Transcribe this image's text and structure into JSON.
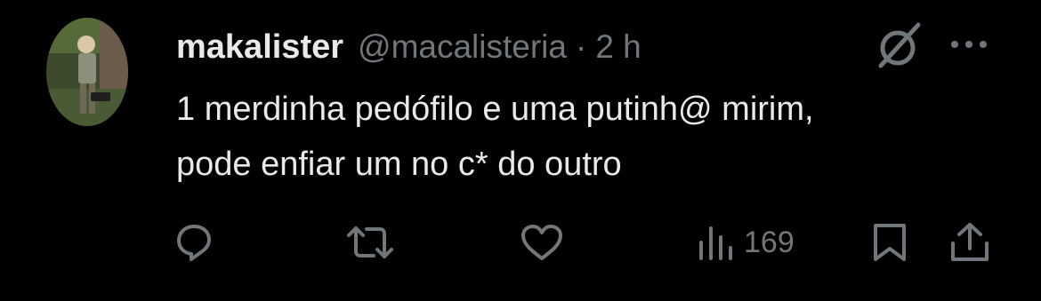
{
  "tweet": {
    "display_name": "makalister",
    "handle": "@macalisteria",
    "separator": "·",
    "timestamp": "2 h",
    "text": "1 merdinha pedófilo e uma putinh@ mirim,\npode enfiar um no c* do outro"
  },
  "actions": {
    "views_count": "169"
  },
  "icons": {
    "avatar": "avatar",
    "grok": "grok-icon",
    "more": "more-icon",
    "reply": "reply-icon",
    "retweet": "retweet-icon",
    "like": "heart-icon",
    "views": "views-icon",
    "bookmark": "bookmark-icon",
    "share": "share-icon"
  },
  "colors": {
    "background": "#000000",
    "primary_text": "#e7e9ea",
    "secondary_text": "#71767b"
  }
}
